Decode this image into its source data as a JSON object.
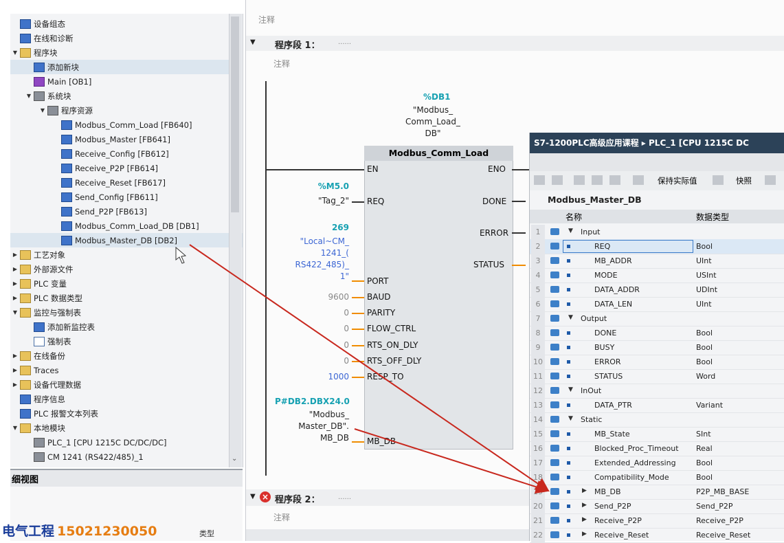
{
  "tree": [
    {
      "label": "设备组态",
      "arrow": "",
      "icon": "ico-blue"
    },
    {
      "label": "在线和诊断",
      "arrow": "",
      "icon": "ico-blue"
    },
    {
      "label": "程序块",
      "arrow": "▼",
      "icon": "ico-folder"
    },
    {
      "label": "添加新块",
      "arrow": "",
      "icon": "ico-blue",
      "selected": true
    },
    {
      "label": "Main [OB1]",
      "arrow": "",
      "icon": "ico-purple"
    },
    {
      "label": "系统块",
      "arrow": "▼",
      "icon": "ico-grey"
    },
    {
      "label": "程序资源",
      "arrow": "▼",
      "icon": "ico-grey"
    },
    {
      "label": "Modbus_Comm_Load [FB640]",
      "arrow": "",
      "icon": "ico-blue"
    },
    {
      "label": "Modbus_Master [FB641]",
      "arrow": "",
      "icon": "ico-blue"
    },
    {
      "label": "Receive_Config [FB612]",
      "arrow": "",
      "icon": "ico-blue"
    },
    {
      "label": "Receive_P2P [FB614]",
      "arrow": "",
      "icon": "ico-blue"
    },
    {
      "label": "Receive_Reset [FB617]",
      "arrow": "",
      "icon": "ico-blue"
    },
    {
      "label": "Send_Config [FB611]",
      "arrow": "",
      "icon": "ico-blue"
    },
    {
      "label": "Send_P2P [FB613]",
      "arrow": "",
      "icon": "ico-blue"
    },
    {
      "label": "Modbus_Comm_Load_DB [DB1]",
      "arrow": "",
      "icon": "ico-blue"
    },
    {
      "label": "Modbus_Master_DB [DB2]",
      "arrow": "",
      "icon": "ico-blue",
      "selected": true
    },
    {
      "label": "工艺对象",
      "arrow": "▶",
      "icon": "ico-folder"
    },
    {
      "label": "外部源文件",
      "arrow": "▶",
      "icon": "ico-folder"
    },
    {
      "label": "PLC 变量",
      "arrow": "▶",
      "icon": "ico-folder"
    },
    {
      "label": "PLC 数据类型",
      "arrow": "▶",
      "icon": "ico-folder"
    },
    {
      "label": "监控与强制表",
      "arrow": "▼",
      "icon": "ico-folder"
    },
    {
      "label": "添加新监控表",
      "arrow": "",
      "icon": "ico-blue"
    },
    {
      "label": "强制表",
      "arrow": "",
      "icon": "ico-table"
    },
    {
      "label": "在线备份",
      "arrow": "▶",
      "icon": "ico-folder"
    },
    {
      "label": "Traces",
      "arrow": "▶",
      "icon": "ico-folder"
    },
    {
      "label": "设备代理数据",
      "arrow": "▶",
      "icon": "ico-folder"
    },
    {
      "label": "程序信息",
      "arrow": "",
      "icon": "ico-blue"
    },
    {
      "label": "PLC 报警文本列表",
      "arrow": "",
      "icon": "ico-blue"
    },
    {
      "label": "本地模块",
      "arrow": "▼",
      "icon": "ico-folder"
    },
    {
      "label": "PLC_1 [CPU 1215C DC/DC/DC]",
      "arrow": "",
      "icon": "ico-grey"
    },
    {
      "label": "CM 1241 (RS422/485)_1",
      "arrow": "",
      "icon": "ico-grey"
    }
  ],
  "detail_view": {
    "title": "细视图",
    "type_label": "类型"
  },
  "watermark": {
    "text": "电气工程",
    "phone": "15021230050"
  },
  "editor": {
    "top_comment": "注释",
    "network1": {
      "title": "程序段 1：",
      "dots": "......",
      "comment": "注释"
    },
    "network2": {
      "title": "程序段 2：",
      "dots": "......",
      "comment": "注释"
    },
    "instance_db": {
      "addr": "%DB1",
      "name_line1": "\"Modbus_",
      "name_line2": "Comm_Load_",
      "name_line3": "DB\""
    },
    "fb_name": "Modbus_Comm_Load",
    "inputs": [
      {
        "pin": "EN"
      },
      {
        "pin": "REQ"
      },
      {
        "pin": "PORT"
      },
      {
        "pin": "BAUD"
      },
      {
        "pin": "PARITY"
      },
      {
        "pin": "FLOW_CTRL"
      },
      {
        "pin": "RTS_ON_DLY"
      },
      {
        "pin": "RTS_OFF_DLY"
      },
      {
        "pin": "RESP_TO"
      },
      {
        "pin": "MB_DB"
      }
    ],
    "outputs": [
      "ENO",
      "DONE",
      "ERROR",
      "STATUS"
    ],
    "req_addr": "%M5.0",
    "req_tag": "\"Tag_2\"",
    "port_value": "269",
    "port_tag": [
      "\"Local~CM_",
      "1241_(",
      "RS422_485)_",
      "1\""
    ],
    "baud": "9600",
    "parity": "0",
    "flow_ctrl": "0",
    "rts_on": "0",
    "rts_off": "0",
    "resp_to": "1000",
    "mbdb_addr": "P#DB2.DBX24.0",
    "mbdb_tag": [
      "\"Modbus_",
      "Master_DB\"."
    ],
    "mbdb_member": "MB_DB"
  },
  "db_panel": {
    "title": "S7-1200PLC高级应用课程 ▸ PLC_1 [CPU 1215C DC",
    "toolbar_keep": "保持实际值",
    "toolbar_snapshot": "快照",
    "db_name": "Modbus_Master_DB",
    "col_name": "名称",
    "col_type": "数据类型",
    "rows": [
      {
        "n": "1",
        "name": "Input",
        "type": "",
        "level": 0,
        "tri": "▼"
      },
      {
        "n": "2",
        "name": "REQ",
        "type": "Bool",
        "level": 1,
        "tri": "",
        "selected": true
      },
      {
        "n": "3",
        "name": "MB_ADDR",
        "type": "UInt",
        "level": 1,
        "tri": ""
      },
      {
        "n": "4",
        "name": "MODE",
        "type": "USInt",
        "level": 1,
        "tri": ""
      },
      {
        "n": "5",
        "name": "DATA_ADDR",
        "type": "UDInt",
        "level": 1,
        "tri": ""
      },
      {
        "n": "6",
        "name": "DATA_LEN",
        "type": "UInt",
        "level": 1,
        "tri": ""
      },
      {
        "n": "7",
        "name": "Output",
        "type": "",
        "level": 0,
        "tri": "▼"
      },
      {
        "n": "8",
        "name": "DONE",
        "type": "Bool",
        "level": 1,
        "tri": ""
      },
      {
        "n": "9",
        "name": "BUSY",
        "type": "Bool",
        "level": 1,
        "tri": ""
      },
      {
        "n": "10",
        "name": "ERROR",
        "type": "Bool",
        "level": 1,
        "tri": ""
      },
      {
        "n": "11",
        "name": "STATUS",
        "type": "Word",
        "level": 1,
        "tri": ""
      },
      {
        "n": "12",
        "name": "InOut",
        "type": "",
        "level": 0,
        "tri": "▼"
      },
      {
        "n": "13",
        "name": "DATA_PTR",
        "type": "Variant",
        "level": 1,
        "tri": ""
      },
      {
        "n": "14",
        "name": "Static",
        "type": "",
        "level": 0,
        "tri": "▼"
      },
      {
        "n": "15",
        "name": "MB_State",
        "type": "SInt",
        "level": 1,
        "tri": ""
      },
      {
        "n": "16",
        "name": "Blocked_Proc_Timeout",
        "type": "Real",
        "level": 1,
        "tri": ""
      },
      {
        "n": "17",
        "name": "Extended_Addressing",
        "type": "Bool",
        "level": 1,
        "tri": ""
      },
      {
        "n": "18",
        "name": "Compatibility_Mode",
        "type": "Bool",
        "level": 1,
        "tri": ""
      },
      {
        "n": "19",
        "name": "MB_DB",
        "type": "P2P_MB_BASE",
        "level": 1,
        "tri": "▶"
      },
      {
        "n": "20",
        "name": "Send_P2P",
        "type": "Send_P2P",
        "level": 1,
        "tri": "▶"
      },
      {
        "n": "21",
        "name": "Receive_P2P",
        "type": "Receive_P2P",
        "level": 1,
        "tri": "▶"
      },
      {
        "n": "22",
        "name": "Receive_Reset",
        "type": "Receive_Reset",
        "level": 1,
        "tri": "▶"
      }
    ]
  }
}
